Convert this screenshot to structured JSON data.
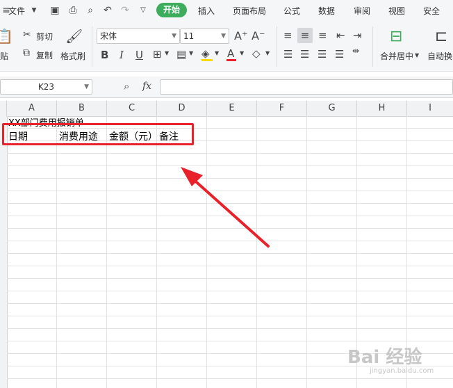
{
  "menubar": {
    "file_label": "文件",
    "tabs": [
      "开始",
      "插入",
      "页面布局",
      "公式",
      "数据",
      "审阅",
      "视图",
      "安全"
    ]
  },
  "ribbon": {
    "paste_label": "贴",
    "cut_label": "剪切",
    "copy_label": "复制",
    "format_painter_label": "格式刷",
    "font_name": "宋体",
    "font_size": "11",
    "bold": "B",
    "italic": "I",
    "underline": "U",
    "merge_center_label": "合并居中",
    "wrap_label": "自动换"
  },
  "formula_bar": {
    "name_box": "K23",
    "fx_label": "fx",
    "formula": ""
  },
  "columns": [
    "A",
    "B",
    "C",
    "D",
    "E",
    "F",
    "G",
    "H",
    "I"
  ],
  "cells": {
    "a1": "XX部门费用报销单",
    "a2": "日期",
    "b2": "消费用途",
    "c2": "金额（元）",
    "d2": "备注"
  },
  "colors": {
    "accent_green": "#3eac5d",
    "annotation_red": "#e8212a"
  },
  "watermark": {
    "main": "Bai 经验",
    "sub": "jingyan.baidu.com"
  }
}
